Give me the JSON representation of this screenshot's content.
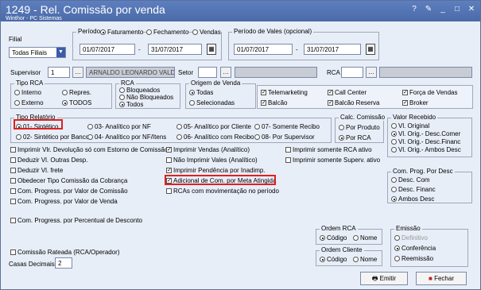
{
  "window": {
    "title": "1249 - Rel. Comissão por venda",
    "subtitle": "Winthor - PC Sistemas",
    "buttons": [
      "?",
      "✎",
      "_",
      "□",
      "✕"
    ]
  },
  "filial": {
    "label": "Filial",
    "value": "Todas Filiais"
  },
  "periodo": {
    "label": "Período:",
    "options": [
      "Faturamento",
      "Fechamento",
      "Vendas"
    ],
    "selected": "Faturamento",
    "start": "01/07/2017",
    "end": "31/07/2017"
  },
  "periodo_vales": {
    "label": "Período de Vales (opcional)",
    "start": "01/07/2017",
    "end": "31/07/2017"
  },
  "supervisor": {
    "label": "Supervisor",
    "code": "1",
    "name": "ARNALDO LEONARDO VALDIVIN"
  },
  "setor": {
    "label": "Setor"
  },
  "rca": {
    "label": "RCA"
  },
  "tipo_rca": {
    "label": "Tipo RCA",
    "options": [
      "Interno",
      "Repres.",
      "Externo",
      "TODOS"
    ],
    "selected": "TODOS"
  },
  "rca_status": {
    "label": "RCA",
    "options": [
      "Bloqueados",
      "Não Bloqueados",
      "Todos"
    ],
    "selected": "Todos"
  },
  "origem_venda": {
    "label": "Origem de Venda",
    "options": [
      "Todas",
      "Selecionadas"
    ],
    "selected": "Todas",
    "checks": [
      "Telemarketing",
      "Call Center",
      "Força de Vendas",
      "Balcão",
      "Balcão Reserva",
      "Broker"
    ]
  },
  "tipo_relatorio": {
    "label": "Tipo Relatório",
    "options": [
      "01- Sintético",
      "02- Sintético por Banco",
      "03- Analítico por NF",
      "04- Analítico por NF/Itens",
      "05- Analítico por Cliente",
      "06- Analítico com Recibo",
      "07- Somente Recibo",
      "08- Por Supervisor"
    ],
    "selected": "01- Sintético"
  },
  "calc_comissao": {
    "label": "Calc. Comissão",
    "options": [
      "Por Produto",
      "Por RCA"
    ],
    "selected": "Por RCA"
  },
  "valor_recebido": {
    "label": "Valor Recebido",
    "options": [
      "Vl. Original",
      "Vl. Orig.- Desc.Comer",
      "Vl. Orig.- Desc.Financ",
      "Vl. Orig.- Ambos Desc"
    ],
    "selected": "Vl. Orig.- Desc.Comer"
  },
  "checks_left": [
    {
      "label": "Imprimir Vlr. Devolução só com Estorno de Comissão",
      "checked": false
    },
    {
      "label": "Deduzir Vl. Outras Desp.",
      "checked": false
    },
    {
      "label": "Deduzir Vl. frete",
      "checked": false
    },
    {
      "label": "Obedecer Tipo Comissão da Cobrança",
      "checked": false
    },
    {
      "label": "Com. Progress. por Valor de Comissão",
      "checked": false
    },
    {
      "label": "Com. Progress. por Valor de Venda",
      "checked": false
    },
    {
      "label": "Com. Progress. por Percentual de Desconto",
      "checked": false
    }
  ],
  "checks_mid": [
    {
      "label": "Imprimir Vendas (Analítico)",
      "checked": true
    },
    {
      "label": "Não Imprimir Vales (Analítico)",
      "checked": false
    },
    {
      "label": "Imprimir Pendência por Inadimp.",
      "checked": true
    },
    {
      "label": "Adicional de Com. por Meta Atingida",
      "checked": true
    },
    {
      "label": "RCAs com movimentação no período",
      "checked": false
    }
  ],
  "checks_right": [
    {
      "label": "Imprimir somente RCA ativo",
      "checked": false
    },
    {
      "label": "Imprimir somente Superv. ativo",
      "checked": false
    }
  ],
  "com_prog_desc": {
    "label": "Com. Prog. Por Desc",
    "options": [
      "Desc. Com",
      "Desc. Financ",
      "Ambos Desc"
    ],
    "selected": "Ambos Desc"
  },
  "ordem_rca": {
    "label": "Ordem RCA",
    "options": [
      "Código",
      "Nome"
    ],
    "selected": "Código"
  },
  "ordem_cliente": {
    "label": "Ordem Cliente",
    "options": [
      "Código",
      "Nome"
    ],
    "selected": "Código"
  },
  "emissao": {
    "label": "Emissão",
    "options": [
      "Definitivo",
      "Conferência",
      "Reemissão"
    ],
    "selected": "Conferência"
  },
  "comissao_rateada": {
    "label": "Comissão Rateada (RCA/Operador)",
    "checked": false
  },
  "casas_decimais": {
    "label": "Casas Decimais",
    "value": "2"
  },
  "actions": {
    "emitir": "Emitir",
    "fechar": "Fechar"
  }
}
